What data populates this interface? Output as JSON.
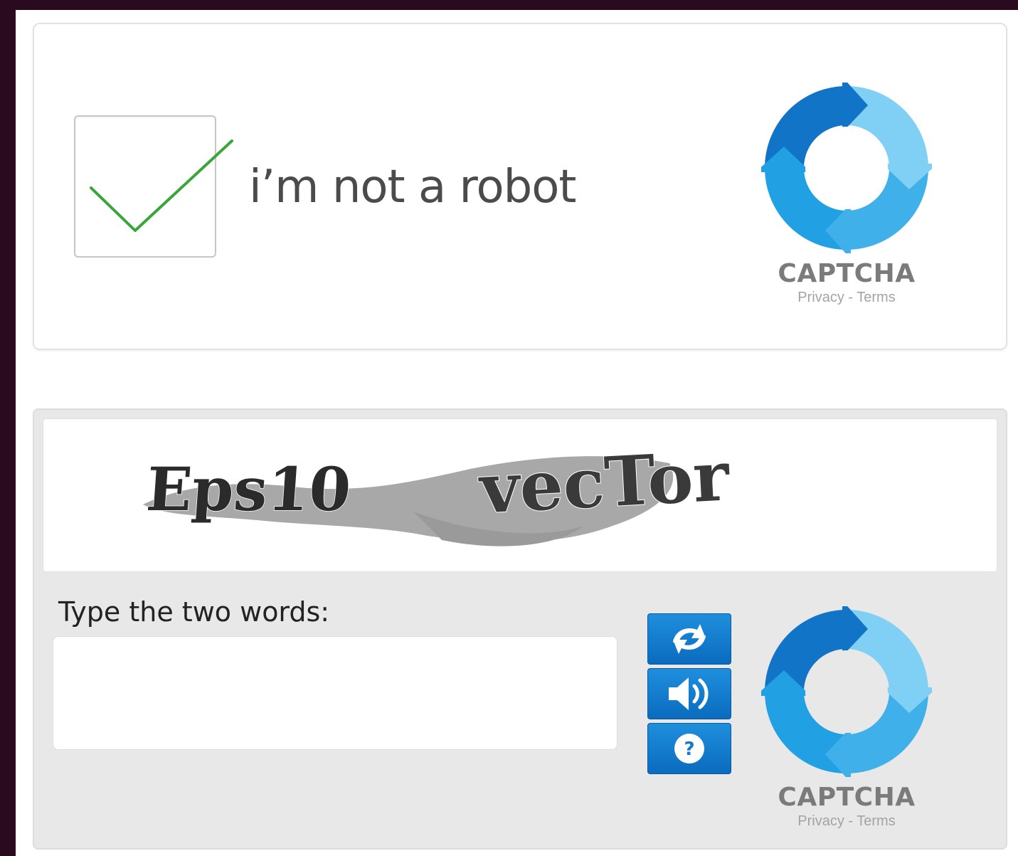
{
  "checkbox_captcha": {
    "checked": true,
    "label": "i’m not a robot",
    "logo": {
      "icon": "captcha-logo-icon",
      "title": "CAPTCHA",
      "privacy": "Privacy",
      "separator": " - ",
      "terms": "Terms"
    }
  },
  "text_captcha": {
    "challenge_words": [
      "Eps10",
      "vecTor"
    ],
    "prompt": "Type the two words:",
    "input_value": "",
    "buttons": [
      {
        "icon": "reload-icon"
      },
      {
        "icon": "audio-icon"
      },
      {
        "icon": "help-icon"
      }
    ],
    "logo": {
      "icon": "captcha-logo-icon",
      "title": "CAPTCHA",
      "privacy": "Privacy",
      "separator": " - ",
      "terms": "Terms"
    }
  },
  "colors": {
    "checkmark": "#3aa63a",
    "button_blue": "#1679cc",
    "logo_blue_dark": "#1a7fd0",
    "logo_blue_light": "#5fc3f0"
  }
}
